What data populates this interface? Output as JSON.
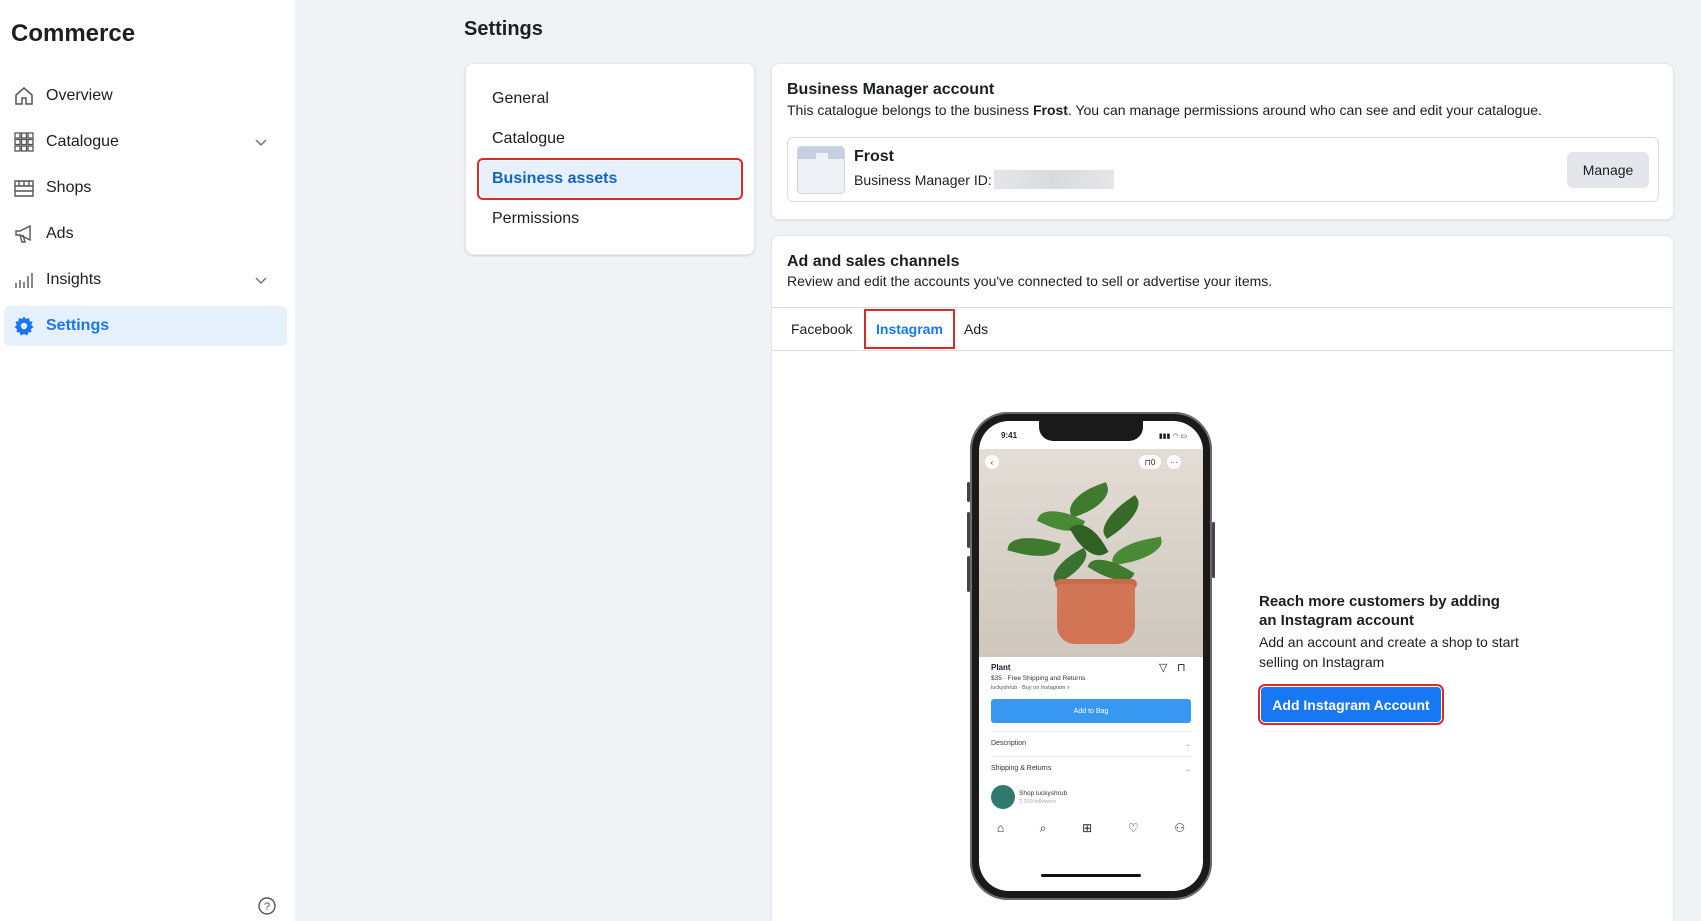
{
  "app": {
    "title": "Commerce"
  },
  "sidebar": {
    "items": [
      {
        "label": "Overview",
        "icon": "home-icon"
      },
      {
        "label": "Catalogue",
        "icon": "grid-icon"
      },
      {
        "label": "Shops",
        "icon": "storefront-icon"
      },
      {
        "label": "Ads",
        "icon": "megaphone-icon"
      },
      {
        "label": "Insights",
        "icon": "bar-chart-icon"
      },
      {
        "label": "Settings",
        "icon": "gear-icon"
      }
    ],
    "active": "Settings"
  },
  "page": {
    "title": "Settings"
  },
  "settings_menu": {
    "items": [
      "General",
      "Catalogue",
      "Business assets",
      "Permissions"
    ],
    "active": "Business assets"
  },
  "business_manager": {
    "title": "Business Manager account",
    "desc_prefix": "This catalogue belongs to the business ",
    "business_name": "Frost",
    "desc_suffix": ". You can manage permissions around who can see and edit your catalogue.",
    "id_label": "Business Manager ID:",
    "manage_label": "Manage"
  },
  "channels": {
    "title": "Ad and sales channels",
    "desc": "Review and edit the accounts you've connected to sell or advertise your items.",
    "tabs": [
      "Facebook",
      "Instagram",
      "Ads"
    ],
    "active_tab": "Instagram",
    "promo_title": "Reach more customers by adding an Instagram account",
    "promo_desc": "Add an account and create a shop to start selling on Instagram",
    "add_button": "Add Instagram Account"
  },
  "phone_mock": {
    "time": "9:41",
    "cart_count": "0",
    "product_name": "Plant",
    "price_line": "$35 · Free Shipping and Returns",
    "seller_line": "luckyshrub · Buy on Instagram »",
    "bag_button": "Add to Bag",
    "rows": [
      "Description",
      "Shipping & Returns"
    ],
    "shop_name": "Shop luckyshrub",
    "shop_followers": "7,209 followers"
  },
  "colors": {
    "accent": "#1877f2",
    "highlight": "#d92b2b",
    "active_bg": "#e7f0fd"
  }
}
